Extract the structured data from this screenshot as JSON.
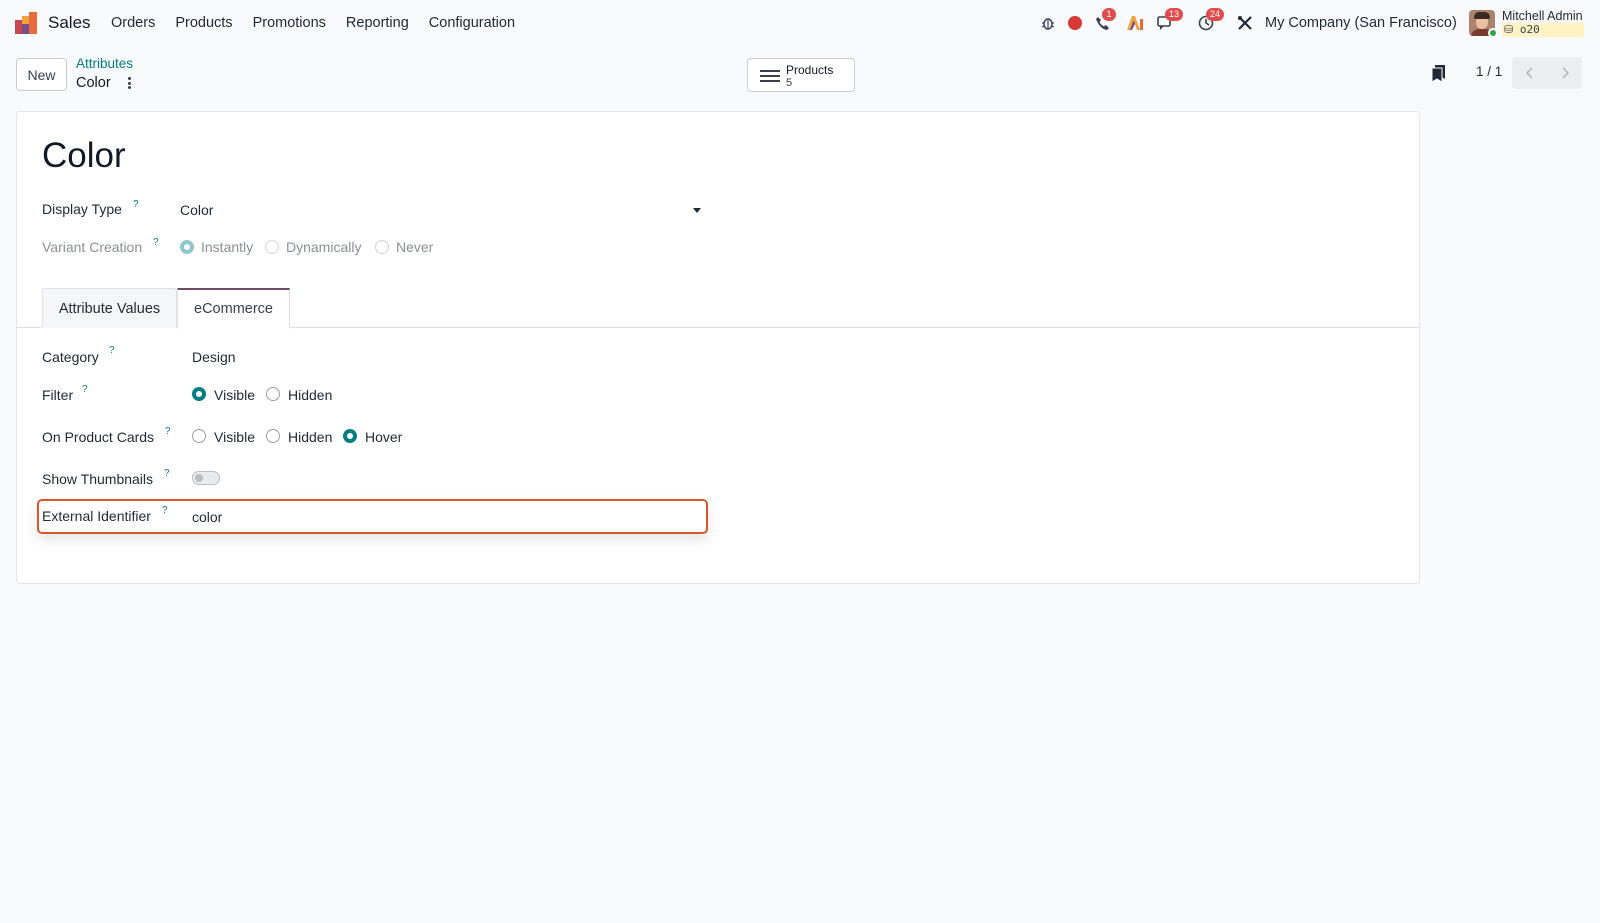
{
  "navbar": {
    "app_name": "Sales",
    "menu": [
      "Orders",
      "Products",
      "Promotions",
      "Reporting",
      "Configuration"
    ],
    "badges": {
      "calls": "1",
      "messages": "13",
      "activities": "24"
    },
    "company": "My Company (San Francisco)",
    "user_name": "Mitchell Admin",
    "user_db": "⛁ o20",
    "icons": [
      "bug-icon",
      "record-icon",
      "phone-icon",
      "ai-icon",
      "chat-icon",
      "clock-icon",
      "tools-icon"
    ]
  },
  "control": {
    "new_label": "New",
    "breadcrumb_parent": "Attributes",
    "breadcrumb_current": "Color",
    "smart_button": {
      "label": "Products",
      "count": "5"
    },
    "pager_value": "1 / 1"
  },
  "form": {
    "record_name": "Color",
    "display_type": {
      "label": "Display Type",
      "value": "Color"
    },
    "variant_creation": {
      "label": "Variant Creation",
      "options": [
        "Instantly",
        "Dynamically",
        "Never"
      ],
      "selected": "Instantly"
    },
    "tabs": [
      "Attribute Values",
      "eCommerce"
    ],
    "active_tab": "eCommerce",
    "category": {
      "label": "Category",
      "value": "Design"
    },
    "filter": {
      "label": "Filter",
      "options": [
        "Visible",
        "Hidden"
      ],
      "selected": "Visible"
    },
    "product_cards": {
      "label": "On Product Cards",
      "options": [
        "Visible",
        "Hidden",
        "Hover"
      ],
      "selected": "Hover"
    },
    "thumbnails": {
      "label": "Show Thumbnails",
      "value": false
    },
    "external_id": {
      "label": "External Identifier",
      "value": "color"
    },
    "help_mark": "?"
  },
  "colors": {
    "accent": "#017e84",
    "brand": "#714b67",
    "focus": "#d9562d",
    "badge": "#e04b4b"
  }
}
